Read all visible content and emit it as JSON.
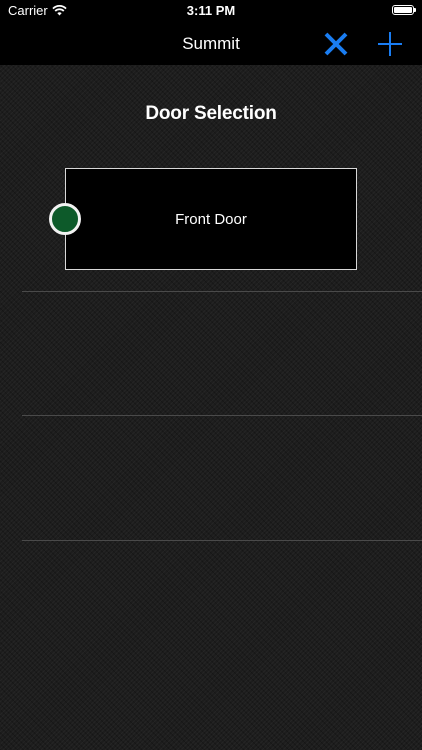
{
  "status_bar": {
    "carrier": "Carrier",
    "time": "3:11 PM"
  },
  "nav": {
    "title": "Summit",
    "close_icon": "close-icon",
    "add_icon": "plus-icon",
    "accent_color": "#1a7df2"
  },
  "main": {
    "section_title": "Door Selection",
    "doors": [
      {
        "label": "Front Door",
        "status_color": "#0d5a2a"
      }
    ]
  }
}
